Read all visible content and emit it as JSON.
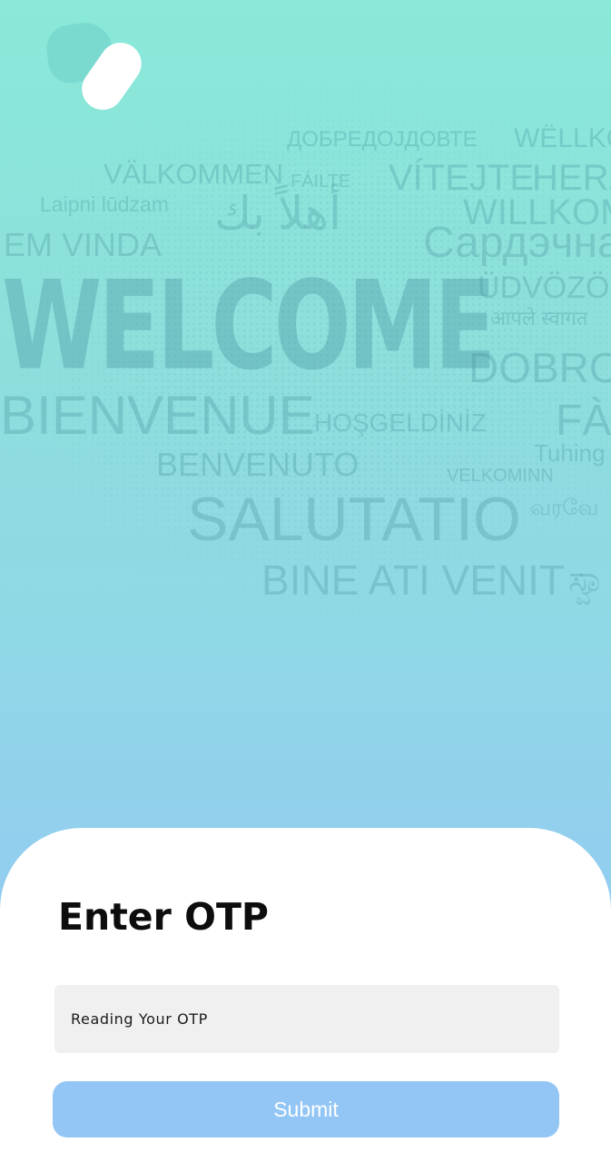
{
  "colors": {
    "gradient_top": "#8ae9d9",
    "gradient_bottom": "#95c7f4",
    "button_bg": "#93c6f5",
    "field_bg": "#f0f0f0",
    "title_text": "#0d0d0d"
  },
  "logo": {
    "icon": "app-logo-icon"
  },
  "background_words": [
    "ДОБРЕДОЈДОВТЕ",
    "WËLLKO",
    "VÄLKOMMEN",
    "FÁILTE",
    "VÍTEJTE",
    "HERZ",
    "Laipni lūdzam",
    "أهلاً بك",
    "WILLKOM",
    "EM VINDA",
    "Сардэчна",
    "WELCOME",
    "ÜDVÖZÖL",
    "आपले स्वागत",
    "DOBRO",
    "BIENVENUE",
    "HOŞGELDİNİZ",
    "FÀI",
    "Tuhing",
    "BENVENUTO",
    "VELKOMINN",
    "SALUTATIO",
    "வரவே",
    "BINE ATI VENIT",
    "ಸ್ವಾ"
  ],
  "otp_card": {
    "title": "Enter OTP",
    "input_value": "Reading Your OTP",
    "submit_label": "Submit"
  }
}
